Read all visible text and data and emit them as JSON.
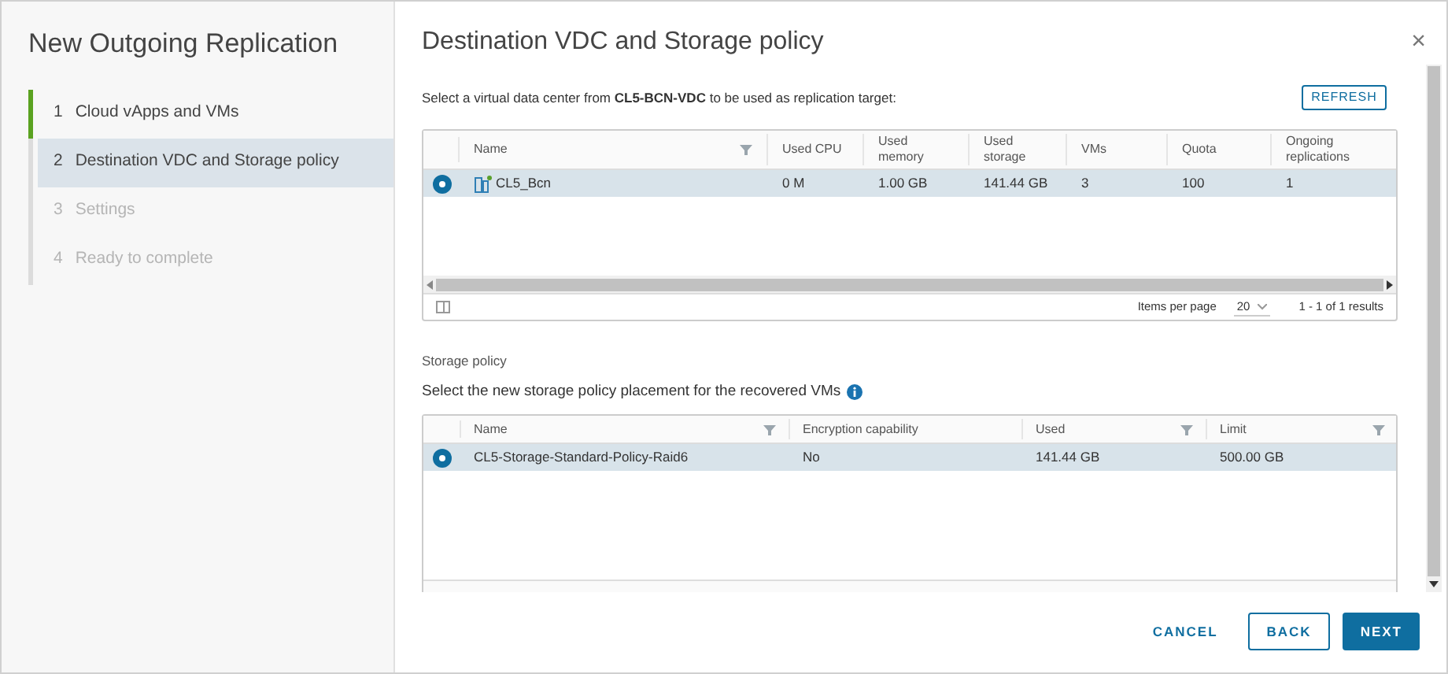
{
  "wizard": {
    "title": "New Outgoing Replication",
    "steps": [
      {
        "number": "1",
        "label": "Cloud vApps and VMs",
        "selected": false,
        "completed": true,
        "disabled": false
      },
      {
        "number": "2",
        "label": "Destination VDC and Storage policy",
        "selected": true,
        "completed": false,
        "disabled": false
      },
      {
        "number": "3",
        "label": "Settings",
        "selected": false,
        "completed": false,
        "disabled": true
      },
      {
        "number": "4",
        "label": "Ready to complete",
        "selected": false,
        "completed": false,
        "disabled": true
      }
    ]
  },
  "page": {
    "title": "Destination VDC and Storage policy",
    "close": "×"
  },
  "vdc": {
    "description": "Select a virtual data center from **CL5-BCN-VDC** to be used as replication target:",
    "refresh": "REFRESH",
    "columns": [
      {
        "label": "Name",
        "filter": true
      },
      {
        "label": "Used CPU",
        "filter": false
      },
      {
        "label": "Used memory",
        "filter": false
      },
      {
        "label": "Used storage",
        "filter": false
      },
      {
        "label": "VMs",
        "filter": false
      },
      {
        "label": "Quota",
        "filter": false
      },
      {
        "label": "Ongoing replications",
        "filter": false
      }
    ],
    "rows": [
      {
        "selected": true,
        "cells": [
          "CL5_Bcn",
          "0 M",
          "1.00 GB",
          "141.44 GB",
          "3",
          "100",
          "1"
        ]
      }
    ],
    "items_per_page_label": "Items per page",
    "items_per_page": "20",
    "results": "1 - 1 of 1 results"
  },
  "storage": {
    "heading": "Storage policy",
    "description": "Select the new storage policy placement for the recovered VMs",
    "columns": [
      {
        "label": "Name",
        "filter": true
      },
      {
        "label": "Encryption capability",
        "filter": false
      },
      {
        "label": "Used",
        "filter": true
      },
      {
        "label": "Limit",
        "filter": true
      }
    ],
    "rows": [
      {
        "selected": true,
        "cells": [
          "CL5-Storage-Standard-Policy-Raid6",
          "No",
          "141.44 GB",
          "500.00 GB"
        ]
      }
    ]
  },
  "buttons": [
    {
      "label": "CANCEL",
      "kind": "flat"
    },
    {
      "label": "BACK",
      "kind": "outline"
    },
    {
      "label": "NEXT",
      "kind": "primary"
    }
  ]
}
